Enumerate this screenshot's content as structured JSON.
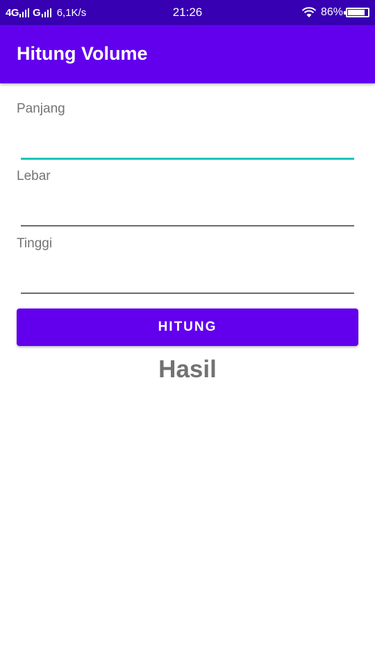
{
  "status_bar": {
    "network_1": "4G",
    "network_2": "G",
    "speed": "6,1K/s",
    "time": "21:26",
    "battery_percent": "86%",
    "battery_level": 0.86,
    "icons": [
      "signal-icon",
      "signal-icon",
      "wifi-icon",
      "battery-icon"
    ]
  },
  "app_bar": {
    "title": "Hitung Volume",
    "color": "#6200ee"
  },
  "form": {
    "fields": [
      {
        "label": "Panjang",
        "value": "",
        "focused": true
      },
      {
        "label": "Lebar",
        "value": "",
        "focused": false
      },
      {
        "label": "Tinggi",
        "value": "",
        "focused": false
      }
    ],
    "accent_color": "#19c5b8"
  },
  "button": {
    "label": "HITUNG",
    "color": "#6200ee"
  },
  "result": {
    "text": "Hasil"
  }
}
